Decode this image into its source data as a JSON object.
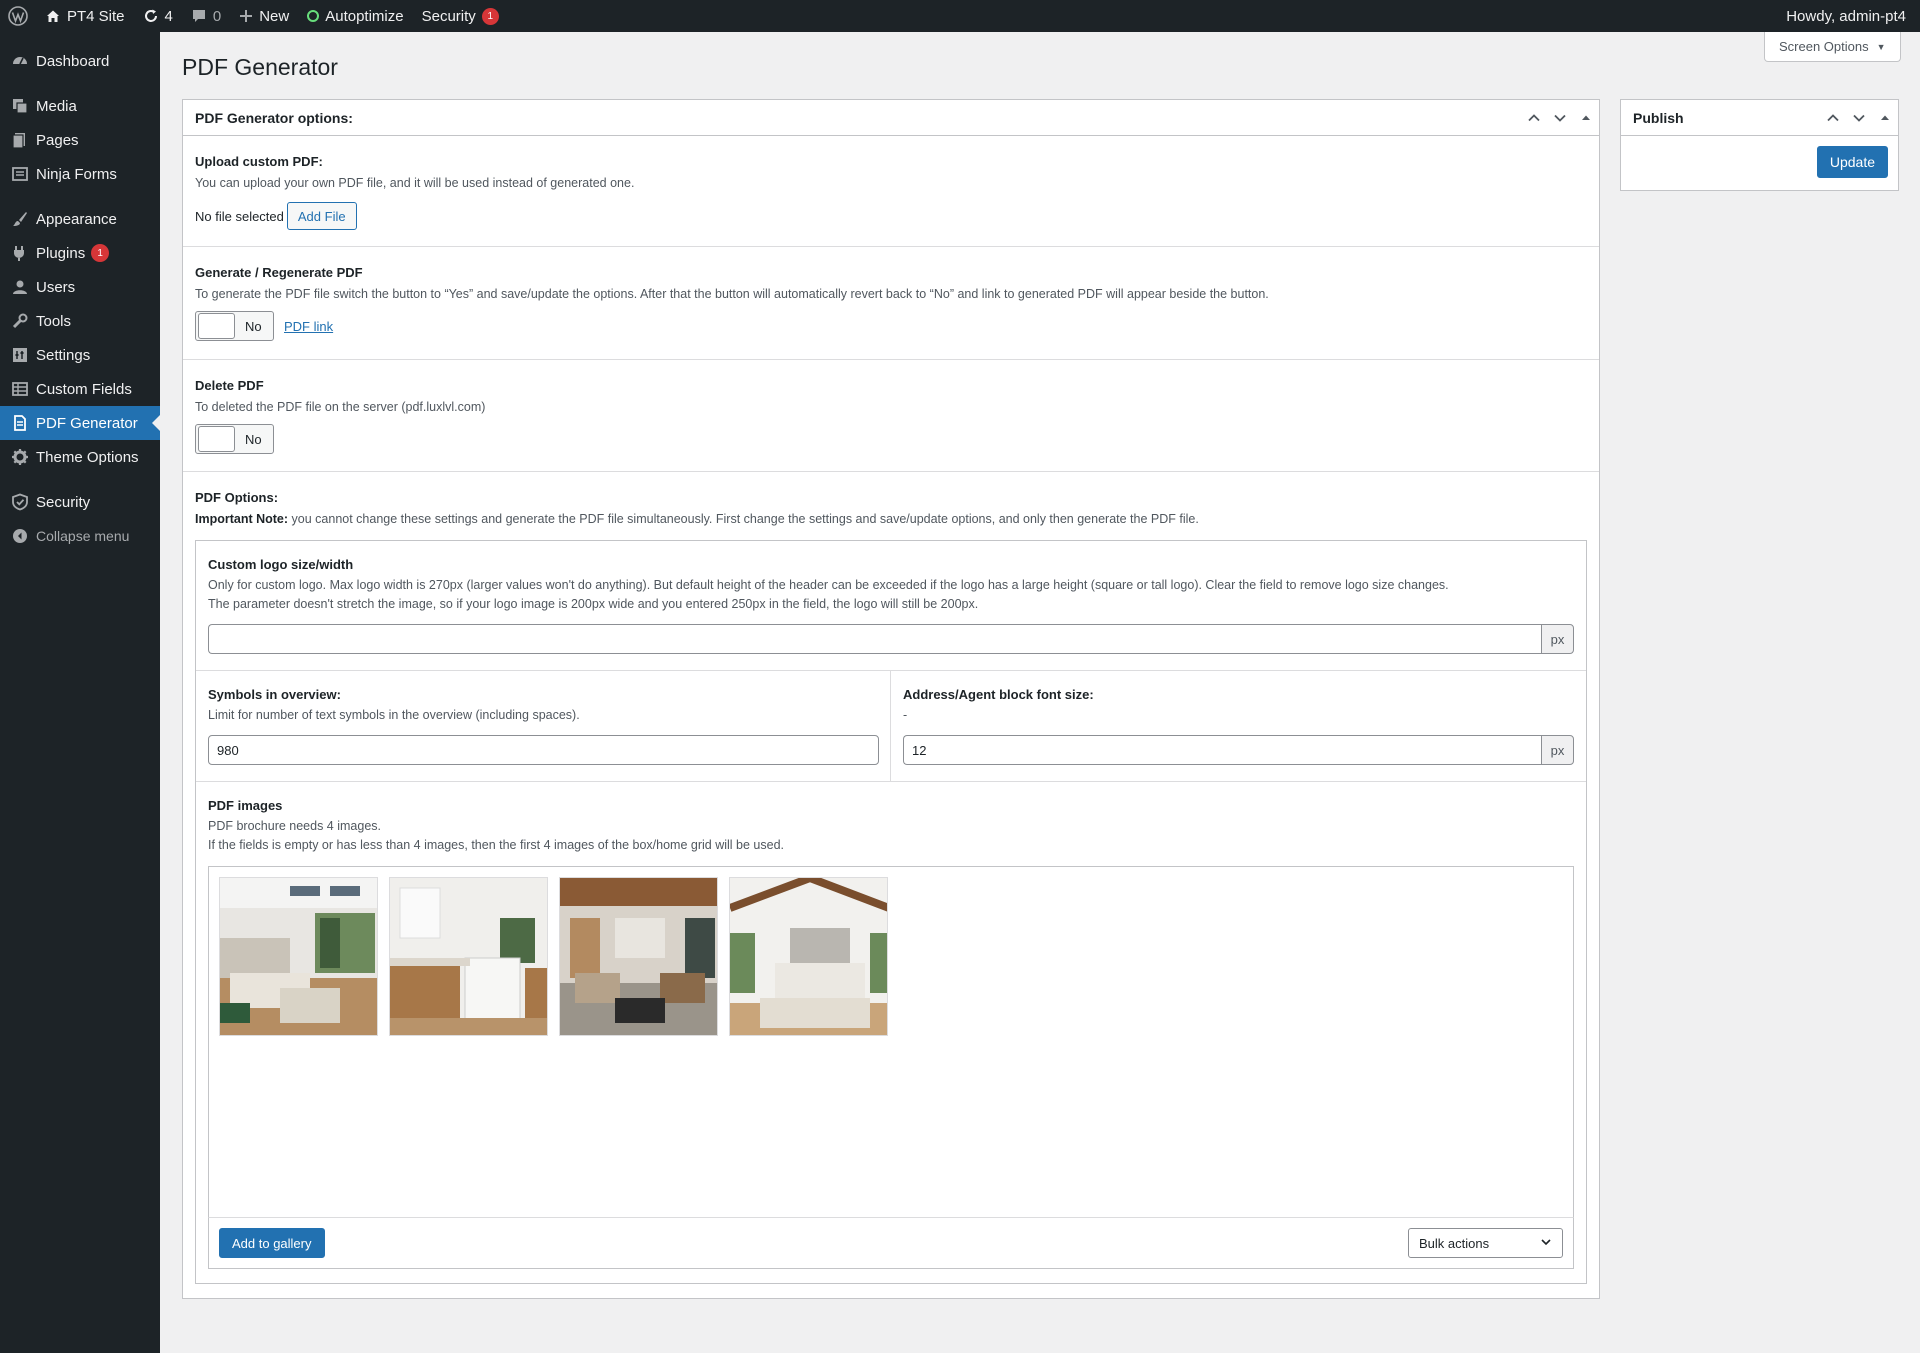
{
  "adminbar": {
    "site_name": "PT4 Site",
    "updates_count": "4",
    "comments_count": "0",
    "new_label": "New",
    "autoptimize_label": "Autoptimize",
    "security_label": "Security",
    "security_badge": "1",
    "howdy": "Howdy, admin-pt4"
  },
  "sidebar": {
    "items": [
      {
        "label": "Dashboard",
        "icon": "dashboard-icon"
      },
      {
        "label": "Media",
        "icon": "media-icon"
      },
      {
        "label": "Pages",
        "icon": "pages-icon"
      },
      {
        "label": "Ninja Forms",
        "icon": "forms-icon"
      },
      {
        "label": "Appearance",
        "icon": "paintbrush-icon"
      },
      {
        "label": "Plugins",
        "icon": "plugin-icon",
        "badge": "1"
      },
      {
        "label": "Users",
        "icon": "users-icon"
      },
      {
        "label": "Tools",
        "icon": "wrench-icon"
      },
      {
        "label": "Settings",
        "icon": "settings-icon"
      },
      {
        "label": "Custom Fields",
        "icon": "table-icon"
      },
      {
        "label": "PDF Generator",
        "icon": "document-icon",
        "active": true
      },
      {
        "label": "Theme Options",
        "icon": "gear-icon"
      },
      {
        "label": "Security",
        "icon": "shield-icon"
      },
      {
        "label": "Collapse menu",
        "icon": "collapse-icon"
      }
    ]
  },
  "header": {
    "screen_options": "Screen Options",
    "title": "PDF Generator"
  },
  "options_box": {
    "title": "PDF Generator options:",
    "upload": {
      "title": "Upload custom PDF:",
      "desc": "You can upload your own PDF file, and it will be used instead of generated one.",
      "status": "No file selected",
      "button": "Add File"
    },
    "generate": {
      "title": "Generate / Regenerate PDF",
      "desc": "To generate the PDF file switch the button to “Yes” and save/update the options. After that the button will automatically revert back to “No” and link to generated PDF will appear beside the button.",
      "toggle": "No",
      "link": "PDF link"
    },
    "delete": {
      "title": "Delete PDF",
      "desc": "To deleted the PDF file on the server (pdf.luxlvl.com)",
      "toggle": "No"
    },
    "pdf_options": {
      "title": "PDF Options:",
      "note_label": "Important Note:",
      "note": "you cannot change these settings and generate the PDF file simultaneously. First change the settings and save/update options, and only then generate the PDF file."
    },
    "logo": {
      "title": "Custom logo size/width",
      "desc1": "Only for custom logo. Max logo width is 270px (larger values won't do anything). But default height of the header can be exceeded if the logo has a large height (square or tall logo). Clear the field to remove logo size changes.",
      "desc2": "The parameter doesn't stretch the image, so if your logo image is 200px wide and you entered 250px in the field, the logo will still be 200px.",
      "value": "",
      "unit": "px"
    },
    "symbols": {
      "title": "Symbols in overview:",
      "desc": "Limit for number of text symbols in the overview (including spaces).",
      "value": "980"
    },
    "address_font": {
      "title": "Address/Agent block font size:",
      "desc": "-",
      "value": "12",
      "unit": "px"
    },
    "images": {
      "title": "PDF images",
      "desc1": "PDF brochure needs 4 images.",
      "desc2": "If the fields is empty or has less than 4 images, then the first 4 images of the box/home grid will be used.",
      "add_button": "Add to gallery",
      "bulk": "Bulk actions"
    }
  },
  "publish": {
    "title": "Publish",
    "button": "Update"
  },
  "colors": {
    "accent": "#2271b1",
    "admin_dark": "#1d2327",
    "badge_red": "#d63638"
  }
}
